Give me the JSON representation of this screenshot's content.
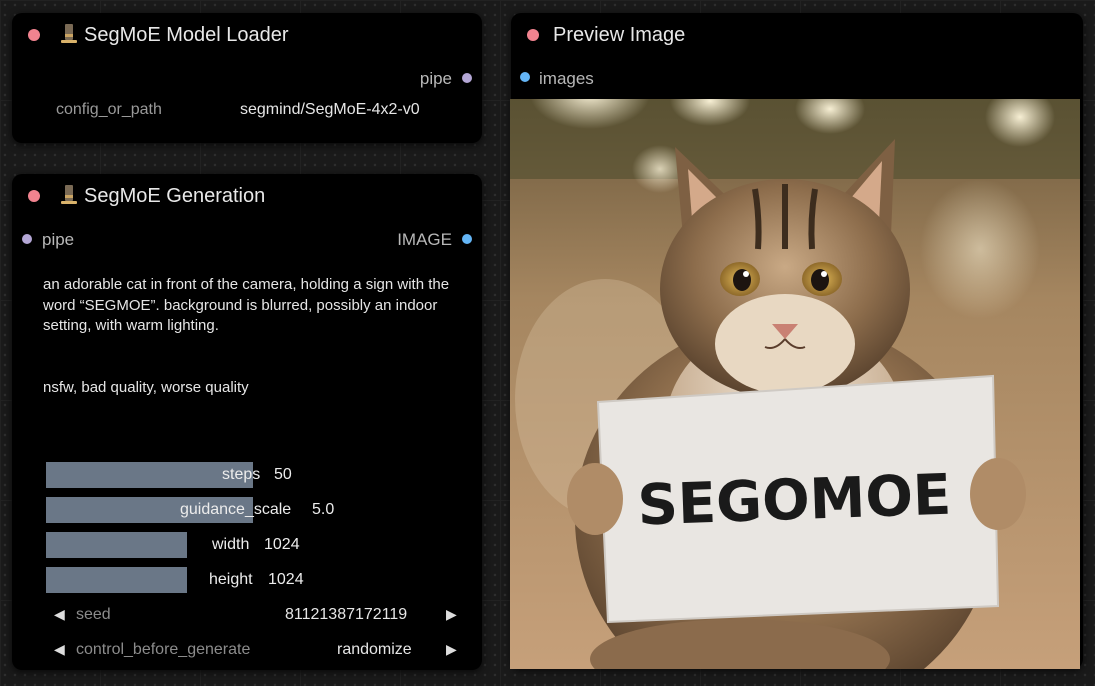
{
  "loader": {
    "title": "SegMoE Model Loader",
    "output_pipe": "pipe",
    "config_label": "config_or_path",
    "config_value": "segmind/SegMoE-4x2-v0"
  },
  "generation": {
    "title": "SegMoE Generation",
    "input_pipe": "pipe",
    "output_image": "IMAGE",
    "positive_prompt": "an adorable cat in front of the camera, holding a sign with the word “SEGMOE”. background is blurred, possibly an indoor setting, with warm lighting.",
    "negative_prompt": "nsfw, bad quality, worse quality",
    "steps": {
      "label": "steps",
      "value": "50",
      "fraction": 0.47
    },
    "guidance_scale": {
      "label": "guidance_scale",
      "value": "5.0",
      "fraction": 0.47
    },
    "width": {
      "label": "width",
      "value": "1024",
      "fraction": 0.32
    },
    "height": {
      "label": "height",
      "value": "1024",
      "fraction": 0.32
    },
    "seed": {
      "label": "seed",
      "value": "81121387172119"
    },
    "control": {
      "label": "control_before_generate",
      "value": "randomize"
    }
  },
  "preview": {
    "title": "Preview Image",
    "input_images": "images",
    "sign_text": "SEGOMOE"
  },
  "colors": {
    "title_dot": "#f1838f",
    "pipe_slot": "#b4a7d6",
    "image_slot": "#64b5f6",
    "slider_fill": "#6a7787"
  }
}
